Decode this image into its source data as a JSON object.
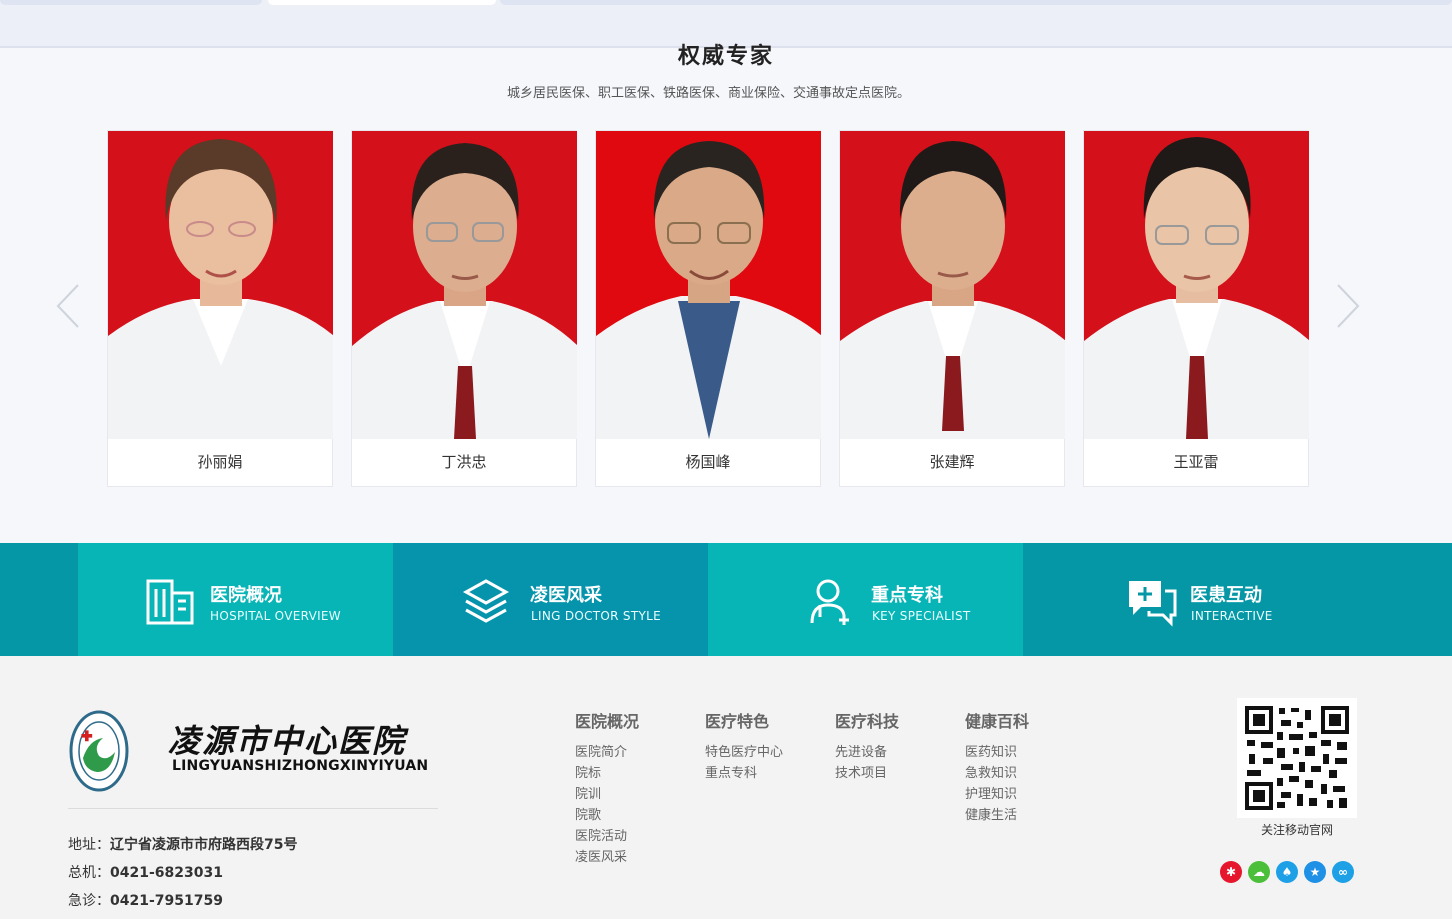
{
  "section": {
    "title": "权威专家",
    "subtitle": "城乡居民医保、职工医保、铁路医保、商业保险、交通事故定点医院。"
  },
  "experts": [
    {
      "name": "孙丽娟"
    },
    {
      "name": "丁洪忠"
    },
    {
      "name": "杨国峰"
    },
    {
      "name": "张建辉"
    },
    {
      "name": "王亚雷"
    }
  ],
  "features": [
    {
      "title": "医院概况",
      "subtitle": "HOSPITAL OVERVIEW",
      "icon": "building-icon"
    },
    {
      "title": "凌医风采",
      "subtitle": "LING DOCTOR STYLE",
      "icon": "layers-icon"
    },
    {
      "title": "重点专科",
      "subtitle": "KEY SPECIALIST",
      "icon": "doctor-icon"
    },
    {
      "title": "医患互动",
      "subtitle": "INTERACTIVE",
      "icon": "chat-plus-icon"
    }
  ],
  "footer": {
    "logo_cn": "凌源市中心医院",
    "logo_en": "LINGYUANSHIZHONGXINYIYUAN",
    "address_label": "地址：",
    "address": "辽宁省凌源市市府路西段75号",
    "phone_label": "总机：",
    "phone": "0421-6823031",
    "emergency_label": "急诊：",
    "emergency": "0421-7951759",
    "columns": [
      {
        "heading": "医院概况",
        "items": [
          "医院简介",
          "院标",
          "院训",
          "院歌",
          "医院活动",
          "凌医风采"
        ]
      },
      {
        "heading": "医疗特色",
        "items": [
          "特色医疗中心",
          "重点专科"
        ]
      },
      {
        "heading": "医疗科技",
        "items": [
          "先进设备",
          "技术项目"
        ]
      },
      {
        "heading": "健康百科",
        "items": [
          "医药知识",
          "急救知识",
          "护理知识",
          "健康生活"
        ]
      }
    ],
    "qr_caption": "关注移动官网",
    "social": [
      {
        "icon": "weibo-icon",
        "color": "#e6162d"
      },
      {
        "icon": "wechat-icon",
        "color": "#4cbf3a"
      },
      {
        "icon": "qq-icon",
        "color": "#1ea0e6"
      },
      {
        "icon": "qzone-icon",
        "color": "#1e90e6"
      },
      {
        "icon": "link-icon",
        "color": "#1ea0e6"
      }
    ]
  }
}
